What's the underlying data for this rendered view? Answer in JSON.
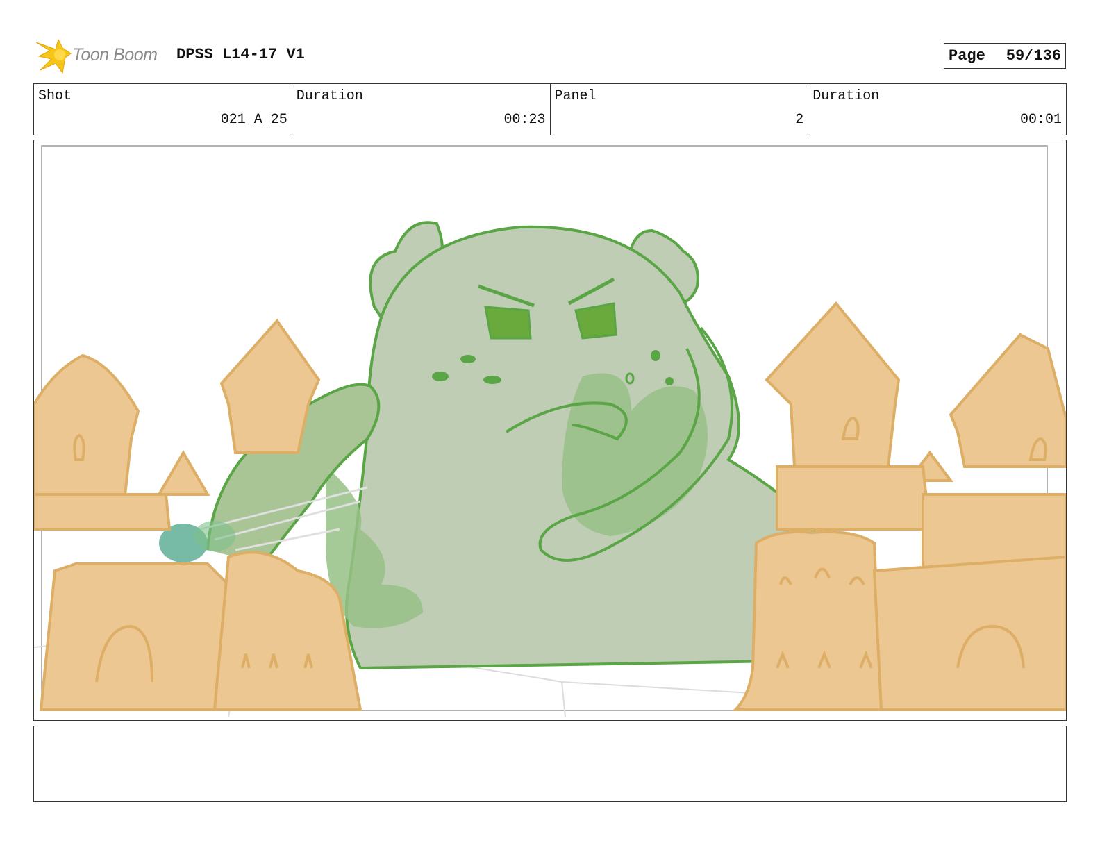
{
  "header": {
    "logo_text": "Toon Boom",
    "project_title": "DPSS L14-17 V1",
    "page_label": "Page",
    "page_number": "59/136"
  },
  "info": {
    "shot_label": "Shot",
    "shot_value": "021_A_25",
    "shot_duration_label": "Duration",
    "shot_duration_value": "00:23",
    "panel_label": "Panel",
    "panel_value": "2",
    "panel_duration_label": "Duration",
    "panel_duration_value": "00:01"
  },
  "panel": {
    "image_name": "sketch-green-monster-between-sandcastles",
    "colors": {
      "monster_fill": "#bfcdb5",
      "monster_line": "#5aa545",
      "sand_fill": "#ecc791",
      "sand_line": "#ddae66",
      "splash": "#5fae96"
    }
  },
  "notes": {
    "text": ""
  },
  "icons": {
    "logo": "toon-boom-star-icon"
  }
}
